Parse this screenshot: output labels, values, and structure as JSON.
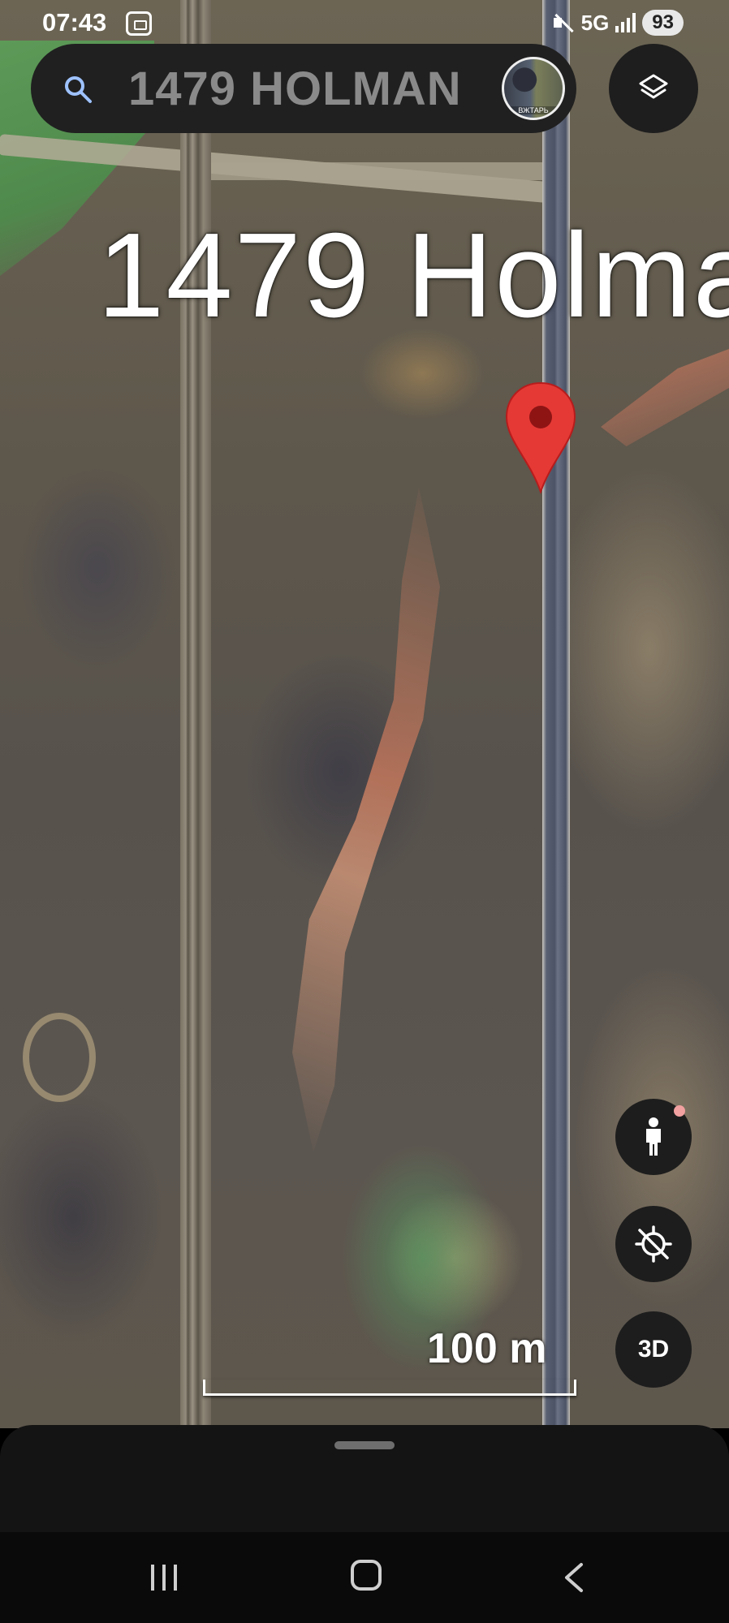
{
  "status_bar": {
    "time": "07:43",
    "network": "5G",
    "battery": "93",
    "icons": [
      "screen-cast-icon",
      "mute-icon",
      "signal-icon"
    ]
  },
  "search": {
    "query": "1479 HOLMAN",
    "avatar_caption": "ВЖТАРЬ"
  },
  "map": {
    "place_label": "1479 Holma",
    "pin_color": "#e53935",
    "scale_label": "100 m"
  },
  "controls": {
    "three_d_label": "3D",
    "icons": [
      "layers-icon",
      "pegman-icon",
      "location-off-icon"
    ]
  },
  "nav": {
    "icons": [
      "recents-icon",
      "home-icon",
      "back-icon"
    ]
  }
}
